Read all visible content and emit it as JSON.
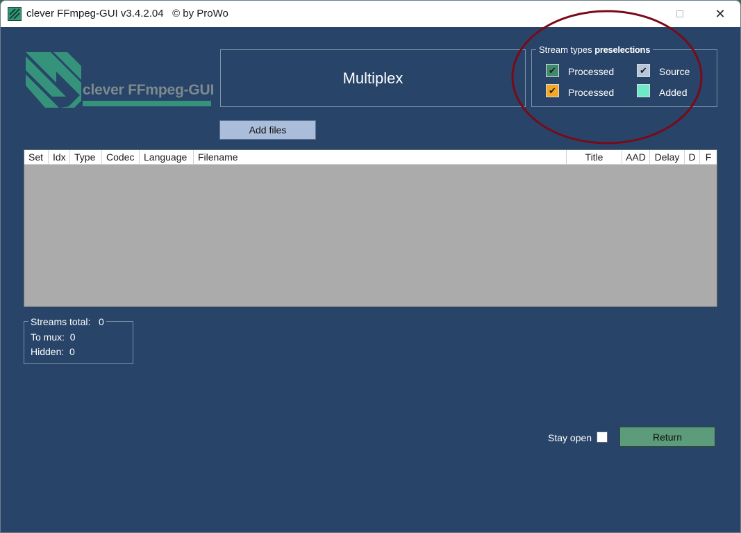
{
  "window": {
    "title": "clever FFmpeg-GUI v3.4.2.04   © by ProWo",
    "close_glyph": "✕"
  },
  "logo": {
    "text": "clever FFmpeg-GUI"
  },
  "mode": {
    "title": "Multiplex"
  },
  "stream_types": {
    "legend_prefix": "Stream types ",
    "legend_bold": "preselections",
    "items": [
      {
        "label": "Processed",
        "color": "#3f8a6c",
        "checked": true
      },
      {
        "label": "Source",
        "color": "#b9c6da",
        "checked": true
      },
      {
        "label": "Processed",
        "color": "#f5a623",
        "checked": true
      },
      {
        "label": "Added",
        "color": "#6fe8c8",
        "checked": false
      }
    ]
  },
  "toolbar": {
    "add_files_label": "Add files"
  },
  "table": {
    "columns": [
      "Set",
      "Idx",
      "Type",
      "Codec",
      "Language",
      "Filename",
      "Title",
      "AAD",
      "Delay",
      "D",
      "F"
    ],
    "rows": []
  },
  "stats": {
    "streams_total_label": "Streams total:",
    "streams_total_value": "0",
    "to_mux_label": "To mux:",
    "to_mux_value": "0",
    "hidden_label": "Hidden:",
    "hidden_value": "0"
  },
  "footer": {
    "stay_open_label": "Stay open",
    "stay_open_checked": false,
    "return_label": "Return"
  },
  "colors": {
    "background": "#284468",
    "brand_green": "#34937a",
    "annotation_circle": "#7a0a17",
    "return_button": "#5c9c7b",
    "add_files_button": "#aabedb"
  }
}
